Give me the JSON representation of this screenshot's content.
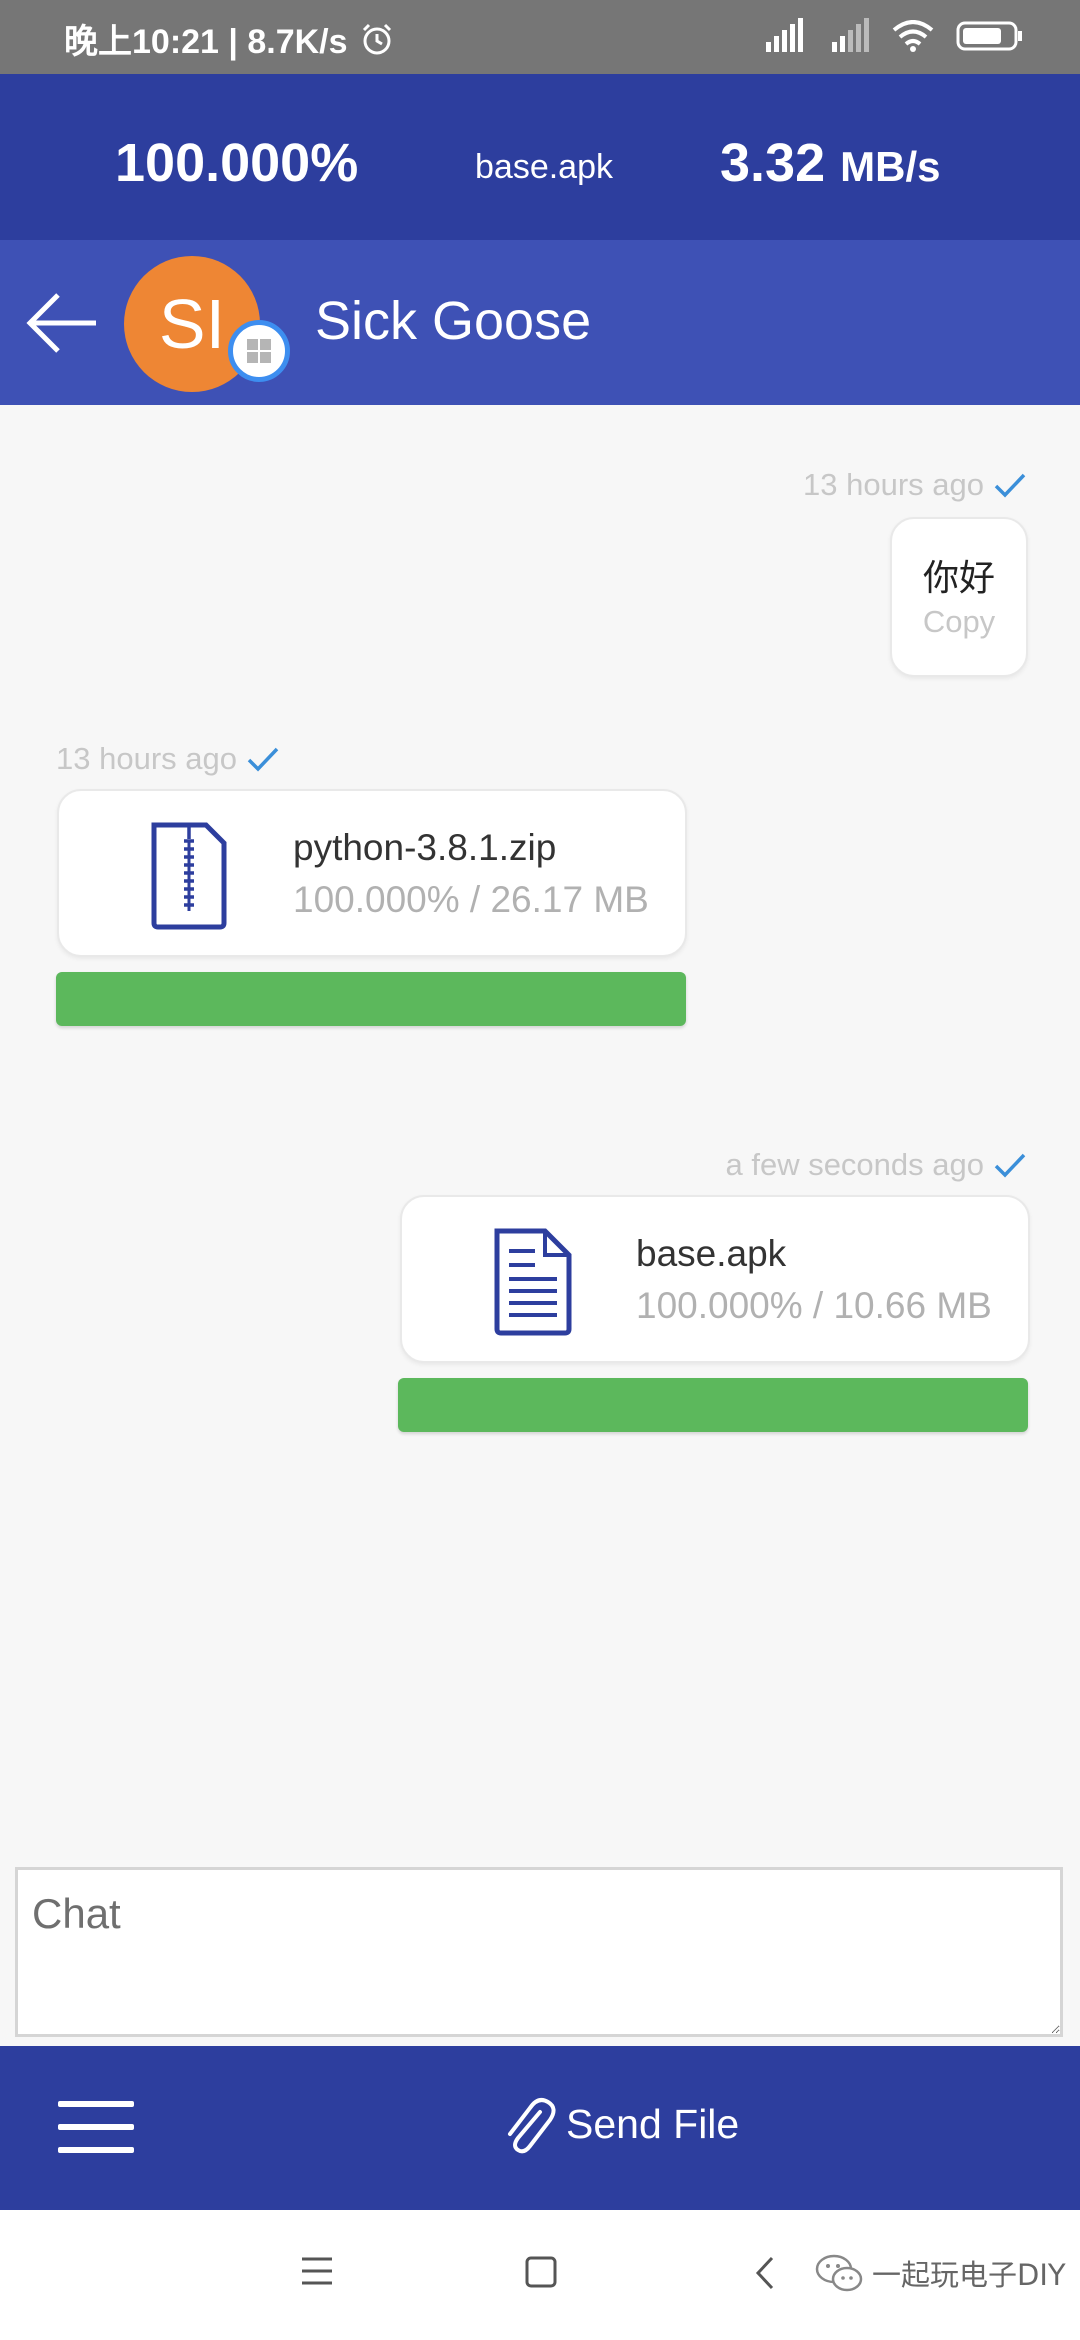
{
  "status_bar": {
    "time_speed": "晚上10:21 | 8.7K/s"
  },
  "transfer": {
    "percent": "100.000%",
    "file": "base.apk",
    "speed_value": "3.32",
    "speed_unit": "MB/s"
  },
  "header": {
    "avatar_initials": "SI",
    "contact_name": "Sick Goose"
  },
  "messages": [
    {
      "timestamp": "13 hours ago",
      "text": "你好",
      "copy_label": "Copy"
    },
    {
      "timestamp": "13 hours ago",
      "file_name": "python-3.8.1.zip",
      "progress_text": "100.000% / 26.17 MB",
      "progress": 1.0,
      "icon": "zip-file-icon"
    },
    {
      "timestamp": "a few seconds ago",
      "file_name": "base.apk",
      "progress_text": "100.000% / 10.66 MB",
      "progress": 1.0,
      "icon": "document-file-icon"
    }
  ],
  "input": {
    "placeholder": "Chat"
  },
  "actions": {
    "send_file_label": "Send File"
  },
  "watermark": {
    "text": "一起玩电子DIY"
  },
  "colors": {
    "primary_dark": "#2d3e9e",
    "primary": "#3e51b5",
    "avatar": "#ee8634",
    "progress": "#5cb85c",
    "check": "#3b8fd9"
  }
}
